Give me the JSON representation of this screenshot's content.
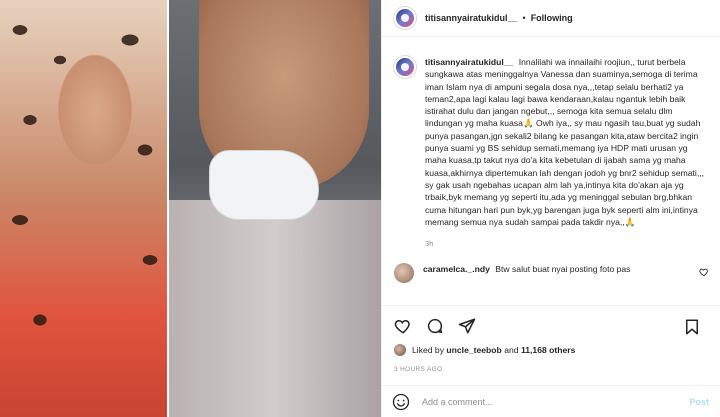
{
  "post": {
    "username": "titisannyairatukidul__",
    "follow_separator": "•",
    "follow_label": "Following",
    "caption_username": "titisannyairatukidul__",
    "caption_text": "Innalilahi wa innailaihi roojiun,, turut berbela sungkawa atas meninggalnya Vanessa dan suaminya,semoga di terima iman Islam nya di ampuni segala dosa nya,,,tetap selalu berhati2 ya teman2,apa lagi kalau lagi bawa kendaraan,kalau ngantuk lebih baik istirahat dulu dan jangan ngebut,,, semoga kita semua selalu dlm lindungan yg maha kuasa🙏 Owh iya,, sy mau ngasih tau,buat yg sudah punya pasangan,jgn sekali2 bilang ke pasangan kita,ataw bercita2 ingin punya suami yg BS sehidup semati,memang iya HDP mati urusan yg maha kuasa,tp takut nya do'a kita kebetulan di ijabah sama yg maha kuasa,akhirnya dipertemukan lah dengan jodoh yg bnr2 sehidup semati,,, sy gak usah ngebahas ucapan alm lah ya,intinya kita do'akan aja yg trbaik,byk memang yg seperti itu,ada yg meninggal sebulan brg,bhkan cuma hitungan hari pun byk,yg barengan juga byk seperti alm ini,intinya memang semua nya sudah sampai pada takdir nya,,🙏",
    "caption_time": "3h",
    "comment": {
      "username": "caramelca._.ndy",
      "text": "Btw salut buat nyai posting foto pas"
    },
    "likes": {
      "prefix": "Liked by",
      "user": "uncle_teebob",
      "connector": "and",
      "others": "11,168 others"
    },
    "timestamp": "3 HOURS AGO",
    "add_comment_placeholder": "Add a comment...",
    "post_label": "Post"
  },
  "icons": {
    "like": "heart-icon",
    "comment": "comment-icon",
    "share": "send-icon",
    "save": "bookmark-icon",
    "emoji": "smiley-icon"
  },
  "colors": {
    "text": "#262626",
    "muted": "#8e8e8e",
    "divider": "#efefef",
    "post_disabled": "#b2dffc"
  }
}
